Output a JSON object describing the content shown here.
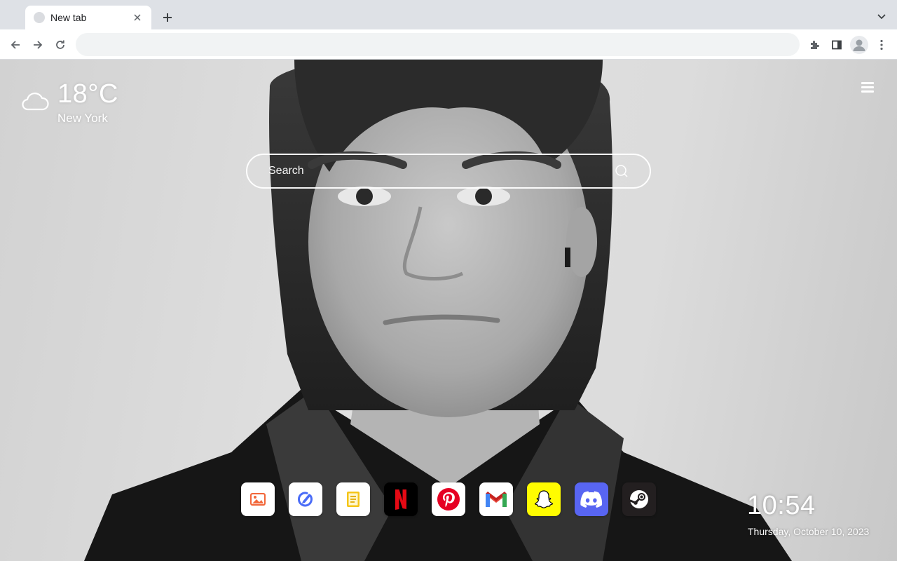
{
  "browser": {
    "tab_title": "New tab",
    "omnibox_value": "",
    "omnibox_placeholder": ""
  },
  "weather": {
    "temperature": "18°C",
    "city": "New York",
    "icon": "cloud-icon"
  },
  "search": {
    "placeholder": "Search"
  },
  "shortcuts": [
    {
      "name": "photos",
      "icon": "image-icon",
      "bg": "#ffffff"
    },
    {
      "name": "check",
      "icon": "check-edit-icon",
      "bg": "#ffffff"
    },
    {
      "name": "notes",
      "icon": "notes-icon",
      "bg": "#ffffff"
    },
    {
      "name": "netflix",
      "icon": "netflix-icon",
      "bg": "#000000"
    },
    {
      "name": "pinterest",
      "icon": "pinterest-icon",
      "bg": "#ffffff"
    },
    {
      "name": "gmail",
      "icon": "gmail-icon",
      "bg": "#ffffff"
    },
    {
      "name": "snapchat",
      "icon": "snapchat-icon",
      "bg": "#fffc00"
    },
    {
      "name": "discord",
      "icon": "discord-icon",
      "bg": "#5865f2"
    },
    {
      "name": "steam",
      "icon": "steam-icon",
      "bg": "#231f20"
    }
  ],
  "clock": {
    "time": "10:54",
    "date": "Thursday, October 10, 2023"
  },
  "colors": {
    "netflix_red": "#e50914",
    "pinterest_red": "#e60023",
    "discord_blurple": "#5865f2",
    "snapchat_yellow": "#fffc00"
  }
}
